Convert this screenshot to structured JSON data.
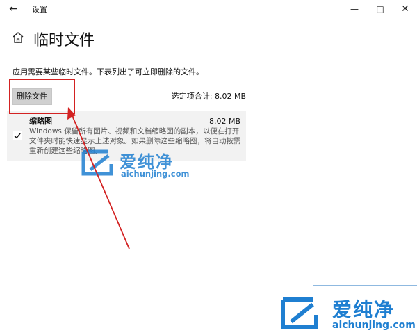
{
  "window": {
    "back_icon": "arrow-left-icon",
    "title": "设置",
    "min_icon": "minimize-icon",
    "max_icon": "maximize-icon",
    "close_icon": "close-icon"
  },
  "page": {
    "home_icon": "home-icon",
    "title": "临时文件",
    "description": "应用需要某些临时文件。下表列出了可立即删除的文件。"
  },
  "actions": {
    "delete_label": "删除文件",
    "total_label": "选定项合计: 8.02 MB"
  },
  "items": [
    {
      "name": "缩略图",
      "size": "8.02 MB",
      "checked": true,
      "description": "Windows 保留所有图片、视频和文档缩略图的副本，以便在打开文件夹时能快速显示上述对象。如果删除这些缩略图，将自动按需重新创建这些缩略图。"
    }
  ],
  "annotation": {
    "highlight_color": "#d32222"
  },
  "watermark": {
    "text_cn": "爱纯净",
    "text_en": "aichunjing.com",
    "color": "#1f7fd1"
  }
}
